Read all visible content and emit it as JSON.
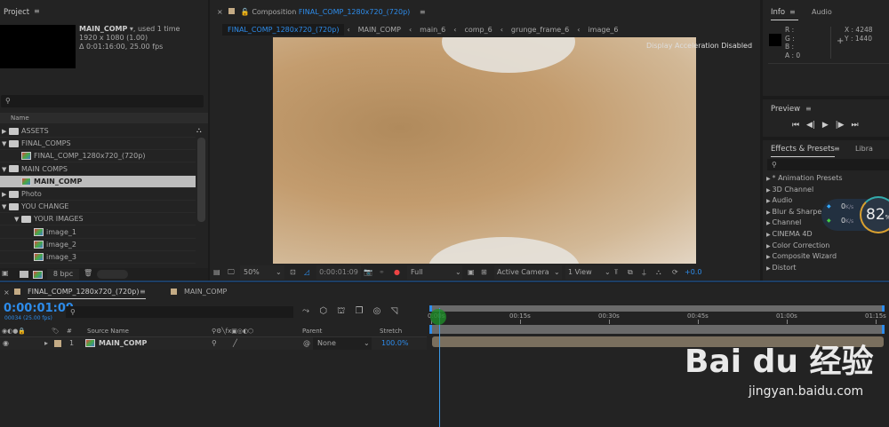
{
  "project": {
    "title": "Project",
    "comp_name": "MAIN_COMP",
    "used": ", used 1 time",
    "resolution": "1920 x 1080 (1.00)",
    "duration": "Δ 0:01:16:00, 25.00 fps",
    "search_placeholder": "",
    "col_name": "Name",
    "bpc": "8 bpc",
    "items": [
      {
        "label": "ASSETS",
        "type": "folder",
        "indent": 0,
        "open": false
      },
      {
        "label": "FINAL_COMPS",
        "type": "folder",
        "indent": 0,
        "open": true
      },
      {
        "label": "FINAL_COMP_1280x720_(720p)",
        "type": "comp",
        "indent": 1
      },
      {
        "label": "MAIN COMPS",
        "type": "folder",
        "indent": 0,
        "open": true
      },
      {
        "label": "MAIN_COMP",
        "type": "comp",
        "indent": 1,
        "selected": true
      },
      {
        "label": "Photo",
        "type": "folder",
        "indent": 0,
        "open": false
      },
      {
        "label": "YOU CHANGE",
        "type": "folder",
        "indent": 0,
        "open": true
      },
      {
        "label": "YOUR IMAGES",
        "type": "folder",
        "indent": 1,
        "open": true
      },
      {
        "label": "image_1",
        "type": "image",
        "indent": 2
      },
      {
        "label": "image_2",
        "type": "image",
        "indent": 2
      },
      {
        "label": "image_3",
        "type": "image",
        "indent": 2
      }
    ]
  },
  "viewer": {
    "prefix": "Composition",
    "comp": "FINAL_COMP_1280x720_(720p)",
    "breadcrumbs": [
      "FINAL_COMP_1280x720_(720p)",
      "MAIN_COMP",
      "main_6",
      "comp_6",
      "grunge_frame_6",
      "image_6"
    ],
    "notice": "Display Acceleration Disabled",
    "zoom": "50%",
    "timecode": "0:00:01:09",
    "resolution": "Full",
    "camera": "Active Camera",
    "views": "1 View",
    "exposure": "+0.0"
  },
  "info": {
    "tab": "Info",
    "tab2": "Audio",
    "r": "R :",
    "g": "G :",
    "b": "B :",
    "a": "A : 0",
    "x": "X : 4248",
    "y": "Y : 1440"
  },
  "preview": {
    "title": "Preview"
  },
  "effects": {
    "tab": "Effects & Presets",
    "tab2": "Libra",
    "items": [
      "* Animation Presets",
      "3D Channel",
      "Audio",
      "Blur & Sharpen",
      "Channel",
      "CINEMA 4D",
      "Color Correction",
      "Composite Wizard",
      "Distort"
    ]
  },
  "net": {
    "up": "0",
    "down": "0",
    "unit": "K/s",
    "percent": "82",
    "percent_unit": "%"
  },
  "timeline": {
    "tab_active": "FINAL_COMP_1280x720_(720p)",
    "tab2": "MAIN_COMP",
    "timecode": "0:00:01:09",
    "frame": "00034 (25.00 fps)",
    "ticks": [
      "0:00s",
      "00:15s",
      "00:30s",
      "00:45s",
      "01:00s",
      "01:15s"
    ],
    "cols": {
      "num": "#",
      "source": "Source Name",
      "parent": "Parent",
      "stretch": "Stretch"
    },
    "layer": {
      "num": "1",
      "name": "MAIN_COMP",
      "parent": "None",
      "stretch": "100.0%"
    }
  },
  "watermark": {
    "logo": "Bai du 经验",
    "url": "jingyan.baidu.com"
  },
  "colors": {
    "accent": "#2d8ceb",
    "layer": "#c4ab85"
  }
}
